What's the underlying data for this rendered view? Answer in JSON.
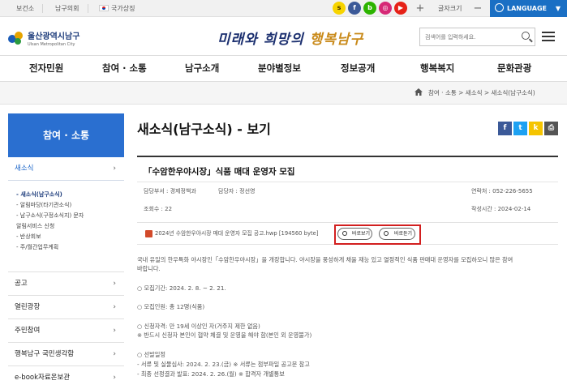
{
  "topbar": {
    "links": [
      "보건소",
      "남구의회",
      "국가상징"
    ],
    "font_size_label": "글자크기",
    "plus": "+",
    "minus": "−",
    "language": "LANGUAGE",
    "sns": [
      {
        "icon": "kakao-story-icon",
        "color": "#f7d400",
        "glyph": "s"
      },
      {
        "icon": "facebook-icon",
        "color": "#3b5998",
        "glyph": "f"
      },
      {
        "icon": "blog-icon",
        "color": "#2db400",
        "glyph": "b"
      },
      {
        "icon": "instagram-icon",
        "color": "#d62976",
        "glyph": "◎"
      },
      {
        "icon": "youtube-icon",
        "color": "#e62117",
        "glyph": "▶"
      }
    ]
  },
  "header": {
    "logo_ko": "울산광역시남구",
    "logo_en": "Ulsan Metropolitan City",
    "slogan_1": "미래와 희망의 ",
    "slogan_2": "행복남구",
    "search_placeholder": "검색어를 입력하세요."
  },
  "gnb": [
    "전자민원",
    "참여 · 소통",
    "남구소개",
    "분야별정보",
    "정보공개",
    "행복복지",
    "문화관광"
  ],
  "breadcrumb": "참여 · 소통 > 새소식 > 새소식(남구소식)",
  "lnb": {
    "title": "참여 · 소통",
    "active": "새소식",
    "sub": [
      {
        "label": "- 새소식(남구소식)",
        "on": true
      },
      {
        "label": "- 알림마당(타기관소식)",
        "on": false
      },
      {
        "label": "- 남구소식(구정소식지) 문자",
        "on": false
      },
      {
        "label": "  알림서비스 신청",
        "on": false
      },
      {
        "label": "- 반상회보",
        "on": false
      },
      {
        "label": "- 주/월간업무계획",
        "on": false
      }
    ],
    "items": [
      "공고",
      "열린광장",
      "주민참여",
      "행복남구 국민생각함",
      "e-book자료온보관"
    ]
  },
  "content": {
    "page_title": "새소식(남구소식) - 보기",
    "post_title": "「수암한우야시장」식품 매대 운영자 모집",
    "dept": "담당부서 : 경제정책과",
    "manager": "담당자 : 정선영",
    "contact": "연락처 : 052-226-5655",
    "views": "조회수 : 22",
    "date": "작성시간 : 2024-02-14",
    "attachment": "2024년 수암한우야시장 매대 운영자 모집 공고.hwp [194560 byte]",
    "btn_preview": "바로보기",
    "btn_download": "바로듣기",
    "body": [
      "국내 유일의 한우특화 야시장인「수암한우야시장」을 개장합니다. 야시장을 풍성하게 채울 재능 있고 열정적인 식품 판매대 운영자를 모집하오니 많은 참여",
      "바랍니다.",
      "",
      "○ 모집기간: 2024. 2. 8. ~ 2. 21.",
      "",
      "○ 모집인원: 총 12명(식품)",
      "",
      "○ 신청자격: 만 19세 이상인 자(거주지 제한 없음)",
      "※ 반드시 신청자 본인이 협약 체결 및 운영을 해야 함(본인 외 운영불가)",
      "",
      "○ 선발일정",
      "- 서류 및 실물심사: 2024. 2. 23.(금) ※ 서류는 첨부파일 공고문 참고",
      "- 최종 선정결과 발표: 2024. 2. 26.(월) ※ 합격자 개별통보"
    ]
  }
}
